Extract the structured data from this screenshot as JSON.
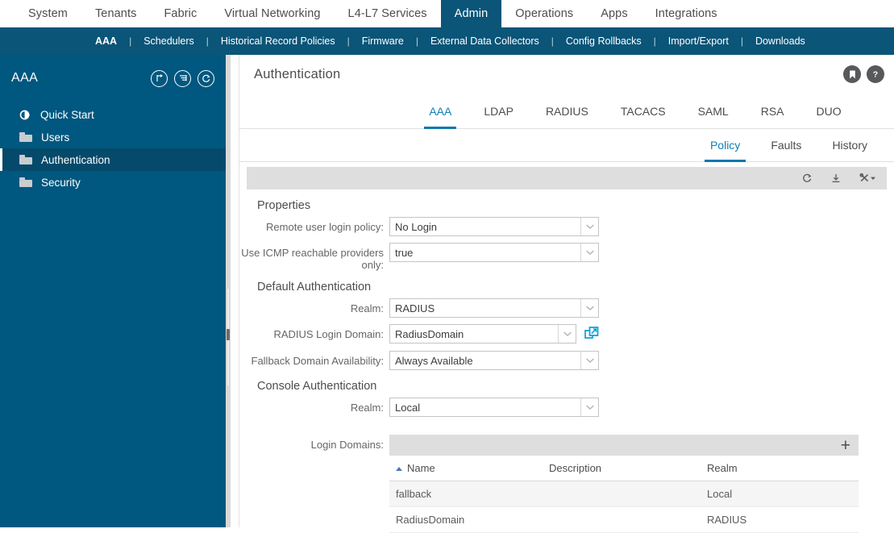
{
  "topnav": {
    "items": [
      {
        "label": "System",
        "active": false
      },
      {
        "label": "Tenants",
        "active": false
      },
      {
        "label": "Fabric",
        "active": false
      },
      {
        "label": "Virtual Networking",
        "active": false
      },
      {
        "label": "L4-L7 Services",
        "active": false
      },
      {
        "label": "Admin",
        "active": true
      },
      {
        "label": "Operations",
        "active": false
      },
      {
        "label": "Apps",
        "active": false
      },
      {
        "label": "Integrations",
        "active": false
      }
    ]
  },
  "subnav": {
    "items": [
      {
        "label": "AAA",
        "active": true
      },
      {
        "label": "Schedulers",
        "active": false
      },
      {
        "label": "Historical Record Policies",
        "active": false
      },
      {
        "label": "Firmware",
        "active": false
      },
      {
        "label": "External Data Collectors",
        "active": false
      },
      {
        "label": "Config Rollbacks",
        "active": false
      },
      {
        "label": "Import/Export",
        "active": false
      },
      {
        "label": "Downloads",
        "active": false
      }
    ],
    "separator": "|"
  },
  "sidebar": {
    "title": "AAA",
    "icons": [
      {
        "name": "collapse-tree-icon"
      },
      {
        "name": "tree-options-icon"
      },
      {
        "name": "refresh-icon"
      }
    ],
    "items": [
      {
        "label": "Quick Start",
        "icon": "quick-start-icon",
        "active": false
      },
      {
        "label": "Users",
        "icon": "folder-icon",
        "active": false
      },
      {
        "label": "Authentication",
        "icon": "folder-icon",
        "active": true
      },
      {
        "label": "Security",
        "icon": "folder-icon",
        "active": false
      }
    ]
  },
  "header": {
    "title": "Authentication",
    "actions": [
      {
        "name": "bookmark-icon"
      },
      {
        "name": "help-icon"
      }
    ]
  },
  "tabs": [
    {
      "label": "AAA",
      "active": true
    },
    {
      "label": "LDAP",
      "active": false
    },
    {
      "label": "RADIUS",
      "active": false
    },
    {
      "label": "TACACS",
      "active": false
    },
    {
      "label": "SAML",
      "active": false
    },
    {
      "label": "RSA",
      "active": false
    },
    {
      "label": "DUO",
      "active": false
    }
  ],
  "subtabs": [
    {
      "label": "Policy",
      "active": true
    },
    {
      "label": "Faults",
      "active": false
    },
    {
      "label": "History",
      "active": false
    }
  ],
  "toolbar": {
    "icons": [
      {
        "name": "refresh-icon"
      },
      {
        "name": "download-icon"
      },
      {
        "name": "tools-menu-icon"
      }
    ]
  },
  "form": {
    "properties_title": "Properties",
    "remote_user_login_policy": {
      "label": "Remote user login policy:",
      "value": "No Login"
    },
    "use_icmp_reachable_providers_only": {
      "label": "Use ICMP reachable providers only:",
      "value": "true"
    },
    "default_auth_title": "Default Authentication",
    "default_realm": {
      "label": "Realm:",
      "value": "RADIUS"
    },
    "radius_login_domain": {
      "label": "RADIUS Login Domain:",
      "value": "RadiusDomain",
      "link_icon": "open-external-icon"
    },
    "fallback_domain_availability": {
      "label": "Fallback Domain Availability:",
      "value": "Always Available"
    },
    "console_auth_title": "Console Authentication",
    "console_realm": {
      "label": "Realm:",
      "value": "Local"
    },
    "login_domains": {
      "label": "Login Domains:",
      "add_label": "+",
      "columns": [
        "Name",
        "Description",
        "Realm"
      ],
      "sort_column": "Name",
      "sort_direction": "asc",
      "rows": [
        {
          "name": "fallback",
          "description": "",
          "realm": "Local"
        },
        {
          "name": "RadiusDomain",
          "description": "",
          "realm": "RADIUS"
        }
      ]
    }
  },
  "colors": {
    "nav_navy": "#0a5578",
    "sidebar_navy": "#00577f",
    "sidebar_active": "#054a6b",
    "accent_blue": "#0978ad",
    "link_cyan": "#15a0db",
    "toolbar_gray": "#dedede"
  }
}
